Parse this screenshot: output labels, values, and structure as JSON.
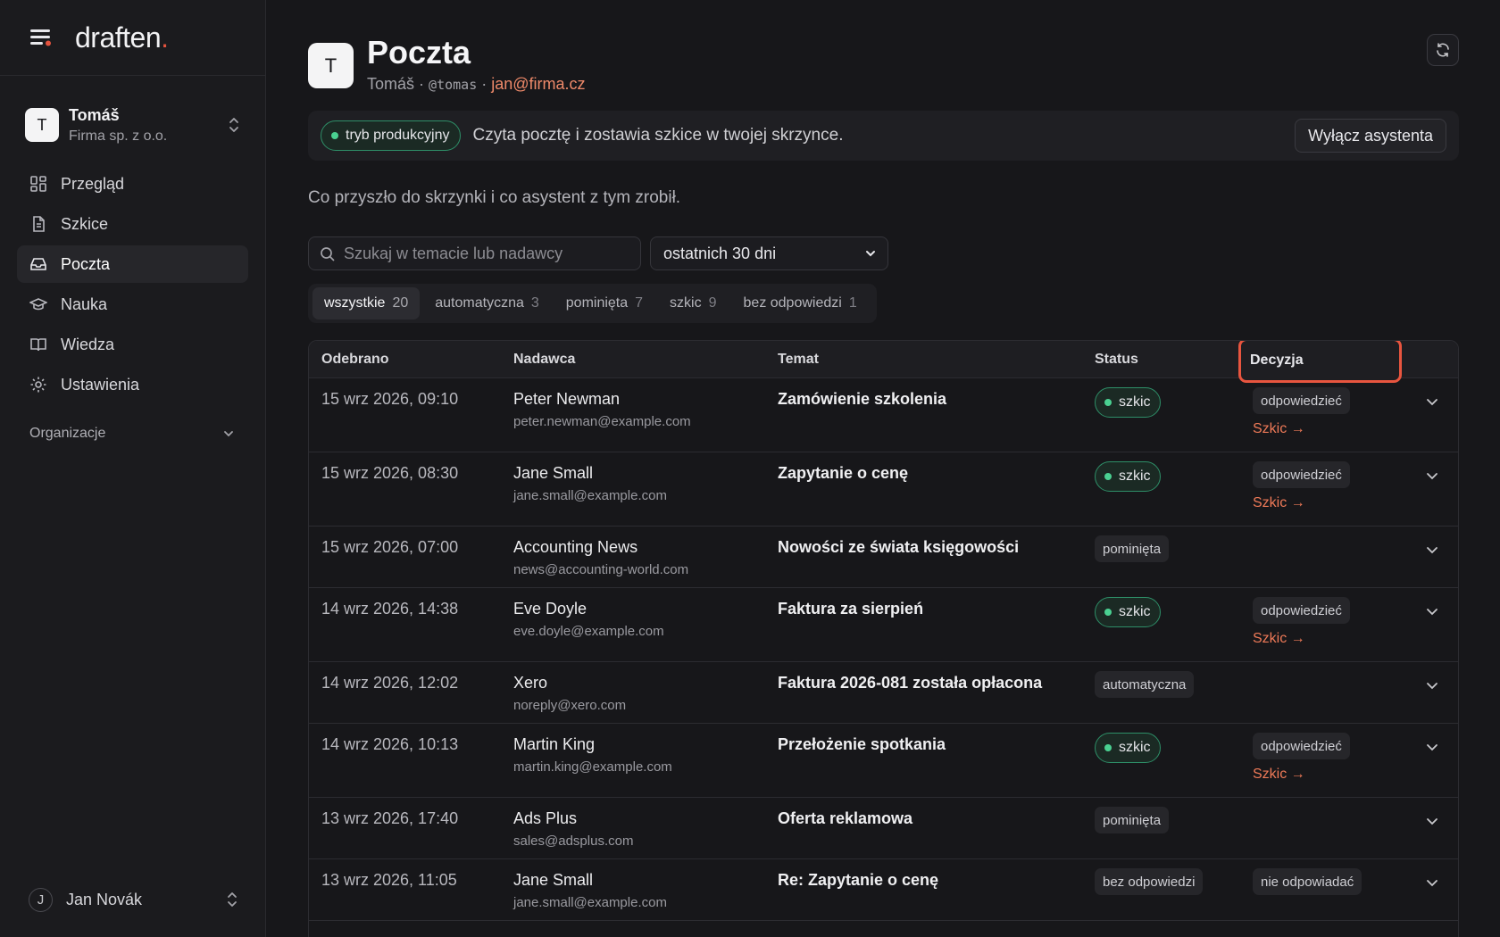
{
  "brand": {
    "name": "draften",
    "dot": "."
  },
  "org": {
    "avatar": "T",
    "name": "Tomáš",
    "company": "Firma sp. z o.o."
  },
  "nav": [
    {
      "label": "Przegląd",
      "icon": "dashboard-icon"
    },
    {
      "label": "Szkice",
      "icon": "document-icon"
    },
    {
      "label": "Poczta",
      "icon": "inbox-icon",
      "active": true
    },
    {
      "label": "Nauka",
      "icon": "graduation-cap-icon"
    },
    {
      "label": "Wiedza",
      "icon": "book-icon"
    },
    {
      "label": "Ustawienia",
      "icon": "gear-icon"
    }
  ],
  "nav_section": "Organizacje",
  "user": {
    "avatar": "J",
    "name": "Jan Novák"
  },
  "page": {
    "avatar": "T",
    "title": "Poczta",
    "meta_name": "Tomáš",
    "meta_sep": "·",
    "meta_handle": "@tomas",
    "meta_email": "jan@firma.cz"
  },
  "banner": {
    "mode": "tryb produkcyjny",
    "text": "Czyta pocztę i zostawia szkice w twojej skrzynce.",
    "button": "Wyłącz asystenta"
  },
  "subtitle": "Co przyszło do skrzynki i co asystent z tym zrobił.",
  "search": {
    "placeholder": "Szukaj w temacie lub nadawcy",
    "value": ""
  },
  "period": {
    "selected": "ostatnich 30 dni"
  },
  "tabs": [
    {
      "label": "wszystkie",
      "count": "20",
      "active": true
    },
    {
      "label": "automatyczna",
      "count": "3"
    },
    {
      "label": "pominięta",
      "count": "7"
    },
    {
      "label": "szkic",
      "count": "9"
    },
    {
      "label": "bez odpowiedzi",
      "count": "1"
    }
  ],
  "table": {
    "columns": {
      "received": "Odebrano",
      "sender": "Nadawca",
      "subject": "Temat",
      "status": "Status",
      "decision": "Decyzja"
    },
    "draft_link": "Szkic →",
    "rows": [
      {
        "date": "15 wrz 2026, 09:10",
        "name": "Peter Newman",
        "email": "peter.newman@example.com",
        "subject": "Zamówienie szkolenia",
        "status": "szkic",
        "decision": "odpowiedzieć",
        "draft": true
      },
      {
        "date": "15 wrz 2026, 08:30",
        "name": "Jane Small",
        "email": "jane.small@example.com",
        "subject": "Zapytanie o cenę",
        "status": "szkic",
        "decision": "odpowiedzieć",
        "draft": true
      },
      {
        "date": "15 wrz 2026, 07:00",
        "name": "Accounting News",
        "email": "news@accounting-world.com",
        "subject": "Nowości ze świata księgowości",
        "status": "pominięta",
        "decision": "",
        "draft": false
      },
      {
        "date": "14 wrz 2026, 14:38",
        "name": "Eve Doyle",
        "email": "eve.doyle@example.com",
        "subject": "Faktura za sierpień",
        "status": "szkic",
        "decision": "odpowiedzieć",
        "draft": true
      },
      {
        "date": "14 wrz 2026, 12:02",
        "name": "Xero",
        "email": "noreply@xero.com",
        "subject": "Faktura 2026-081 została opłacona",
        "status": "automatyczna",
        "decision": "",
        "draft": false
      },
      {
        "date": "14 wrz 2026, 10:13",
        "name": "Martin King",
        "email": "martin.king@example.com",
        "subject": "Przełożenie spotkania",
        "status": "szkic",
        "decision": "odpowiedzieć",
        "draft": true
      },
      {
        "date": "13 wrz 2026, 17:40",
        "name": "Ads Plus",
        "email": "sales@adsplus.com",
        "subject": "Oferta reklamowa",
        "status": "pominięta",
        "decision": "",
        "draft": false
      },
      {
        "date": "13 wrz 2026, 11:05",
        "name": "Jane Small",
        "email": "jane.small@example.com",
        "subject": "Re: Zapytanie o cenę",
        "status": "bez odpowiedzi",
        "decision": "nie odpowiadać",
        "draft": false
      }
    ]
  },
  "colors": {
    "accent": "#e3533e",
    "link": "#ef8a6a",
    "success": "#4ad091",
    "highlight": "#e8553f"
  }
}
